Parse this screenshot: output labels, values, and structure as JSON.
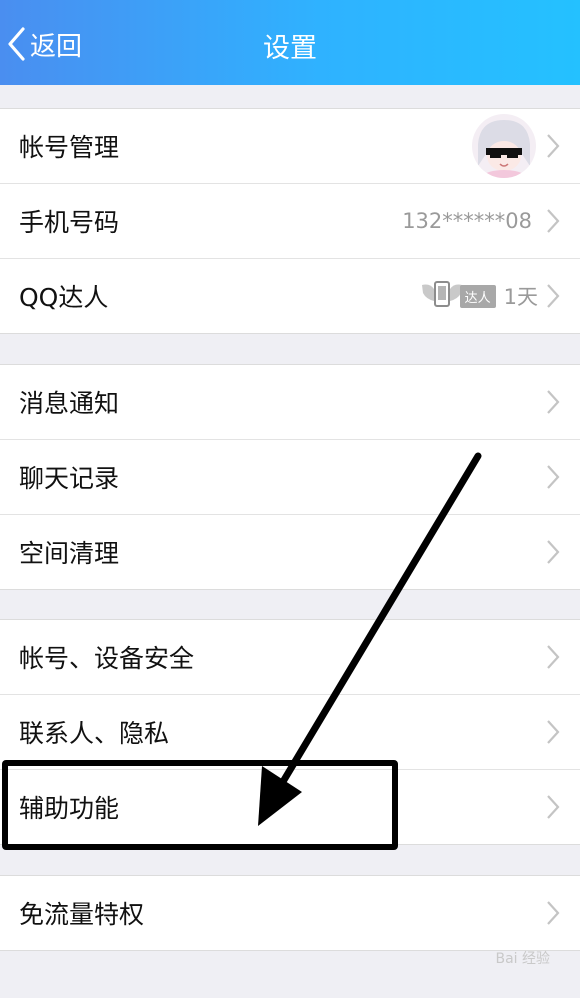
{
  "header": {
    "back_label": "返回",
    "title": "设置",
    "gradient": [
      "#4a8ef0",
      "#24c1ff"
    ]
  },
  "groups": [
    {
      "items": [
        {
          "label": "帐号管理",
          "trailing": "avatar"
        },
        {
          "label": "手机号码",
          "value": "132******08"
        },
        {
          "label": "QQ达人",
          "badge": "达人",
          "days": "1天"
        }
      ]
    },
    {
      "items": [
        {
          "label": "消息通知"
        },
        {
          "label": "聊天记录"
        },
        {
          "label": "空间清理"
        }
      ]
    },
    {
      "items": [
        {
          "label": "帐号、设备安全"
        },
        {
          "label": "联系人、隐私"
        },
        {
          "label": "辅助功能",
          "highlighted": true
        }
      ]
    },
    {
      "items": [
        {
          "label": "免流量特权"
        }
      ]
    }
  ],
  "watermark": "Bai 经验",
  "colors": {
    "background": "#efeff4",
    "value_text": "#9a9a9a",
    "highlight_border": "#000000"
  },
  "icons": [
    "chevron-left-icon",
    "chevron-right-icon",
    "avatar",
    "daren-wings-icon"
  ]
}
